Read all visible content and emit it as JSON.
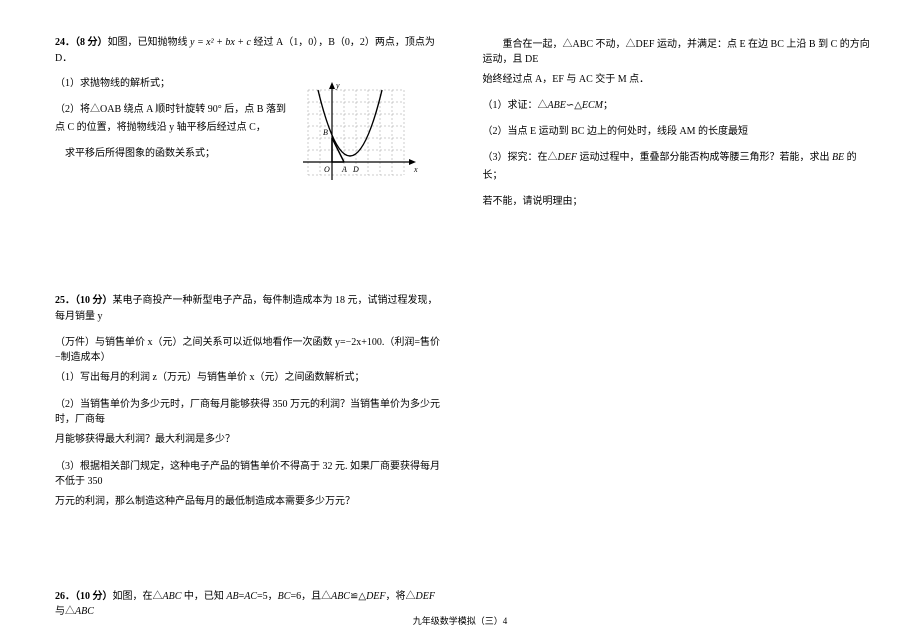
{
  "problem24": {
    "number": "24．",
    "points": "（8 分）",
    "intro_part1": "如图，已知抛物线 ",
    "formula": "y = x² + bx + c",
    "intro_part2": " 经过 A（1，0），B（0，2）两点，顶点为 D．",
    "q1": "（1）求抛物线的解析式；",
    "q2_part1": "（2）将△OAB 绕点 A 顺时针旋转 90° 后，点 B 落到点 C 的位置，将抛物线沿 y 轴平移后经过点 C，",
    "q2_part2": "求平移后所得图象的函数关系式；",
    "graph": {
      "y_label": "y",
      "x_label": "x",
      "point_O": "O",
      "point_A": "A",
      "point_B": "B",
      "point_D": "D"
    }
  },
  "problem25": {
    "number": "25．",
    "points": "（10 分）",
    "intro_part1": "某电子商投产一种新型电子产品，每件制造成本为 18 元，试销过程发现，每月销量 y",
    "intro_part2": "（万件）与销售单价 x（元）之间关系可以近似地看作一次函数 y=−2x+100.（利润=售价−制造成本）",
    "q1": "（1）写出每月的利润 z（万元）与销售单价 x（元）之间函数解析式；",
    "q2_part1": "（2）当销售单价为多少元时，厂商每月能够获得 350 万元的利润？当销售单价为多少元时，厂商每",
    "q2_part2": "月能够获得最大利润？最大利润是多少？",
    "q3_part1": "（3）根据相关部门规定，这种电子产品的销售单价不得高于 32 元. 如果厂商要获得每月不低于 350",
    "q3_part2": "万元的利润，那么制造这种产品每月的最低制造成本需要多少万元？"
  },
  "problem26": {
    "number": "26．",
    "points": "（10 分）",
    "intro_part1": "如图，在△",
    "abc_italic": "ABC",
    "intro_part2": " 中，已知 ",
    "ab": "AB",
    "eq": "=",
    "ac": "AC",
    "val5": "=5，",
    "bc": "BC",
    "val6": "=6，且△",
    "abc2": "ABC",
    "cong": "≌△",
    "def": "DEF",
    "comma": "，将△",
    "def2": "DEF",
    "with": " 与△",
    "abc3": "ABC"
  },
  "problem26_cont": {
    "line1_part1": "重合在一起，△ABC 不动，△DEF 运动，并满足：点 E 在边 BC 上沿 B 到 C 的方向运动，且 DE",
    "line1_part2": "始终经过点 A，EF 与 AC 交于 M 点．",
    "q1_part1": "（1）求证：△",
    "abe": "ABE",
    "sim": "∽△",
    "ecm": "ECM",
    "semi": "；",
    "q2": "（2）当点 E 运动到 BC 边上的何处时，线段 AM 的长度最短",
    "q3_part1": "（3）探究：在△",
    "def_i": "DEF",
    "q3_part2": " 运动过程中，重叠部分能否构成等腰三角形？若能，求出 ",
    "be": "BE",
    "q3_part3": " 的长；",
    "q3_part4": "若不能，请说明理由；"
  },
  "footer": "九年级数学模拟（三）4"
}
